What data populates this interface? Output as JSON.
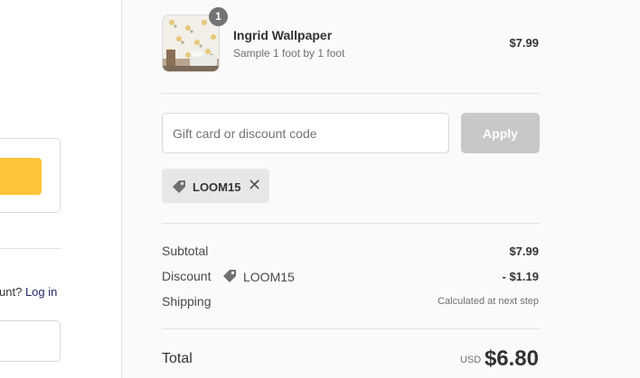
{
  "left": {
    "account_prompt": "unt?",
    "login_link": "Log in"
  },
  "cart": {
    "items": [
      {
        "name": "Ingrid Wallpaper",
        "variant": "Sample 1 foot by 1 foot",
        "price": "$7.99",
        "quantity": "1",
        "thumbnail_icon": "wallpaper-product-image"
      }
    ]
  },
  "discount": {
    "placeholder": "Gift card or discount code",
    "apply_label": "Apply",
    "applied_code": "LOOM15",
    "remove_icon": "close-icon"
  },
  "summary": {
    "subtotal_label": "Subtotal",
    "subtotal_value": "$7.99",
    "discount_label": "Discount",
    "discount_code": "LOOM15",
    "discount_value": "- $1.19",
    "shipping_label": "Shipping",
    "shipping_value": "Calculated at next step",
    "total_label": "Total",
    "currency": "USD",
    "total_value": "$6.80"
  },
  "colors": {
    "express_button": "#ffc439",
    "apply_disabled": "#c8c8c8",
    "summary_bg": "#fafafa"
  }
}
